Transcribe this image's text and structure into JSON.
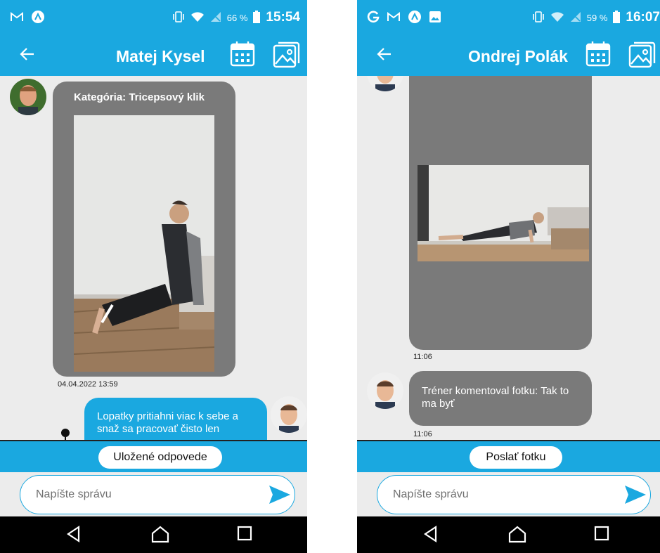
{
  "left": {
    "status": {
      "carrier_icons": [
        "gmail-icon",
        "app-icon"
      ],
      "battery": "66 %",
      "time": "15:54"
    },
    "header": {
      "title": "Matej Kysel"
    },
    "messages": {
      "category": "Kategória: Tricepsový klik",
      "ts1": "04.04.2022 13:59",
      "text": "Lopatky pritiahni viac k sebe a snaž sa pracovať čisto len"
    },
    "reply_button": "Uložené odpovede",
    "input_placeholder": "Napíšte správu"
  },
  "right": {
    "status": {
      "carrier_icons": [
        "google-icon",
        "gmail-icon",
        "app-icon",
        "gallery-icon"
      ],
      "battery": "59 %",
      "time": "16:07"
    },
    "header": {
      "title": "Ondrej Polák"
    },
    "messages": {
      "ts1": "11:06",
      "text": "Tréner komentoval fotku: Tak to ma byť",
      "ts2": "11:06"
    },
    "reply_button": "Poslať fotku",
    "input_placeholder": "Napíšte správu"
  },
  "colors": {
    "primary": "#1aa8e0",
    "bubble_gray": "#7a7a7a",
    "chat_bg": "#ececec"
  }
}
